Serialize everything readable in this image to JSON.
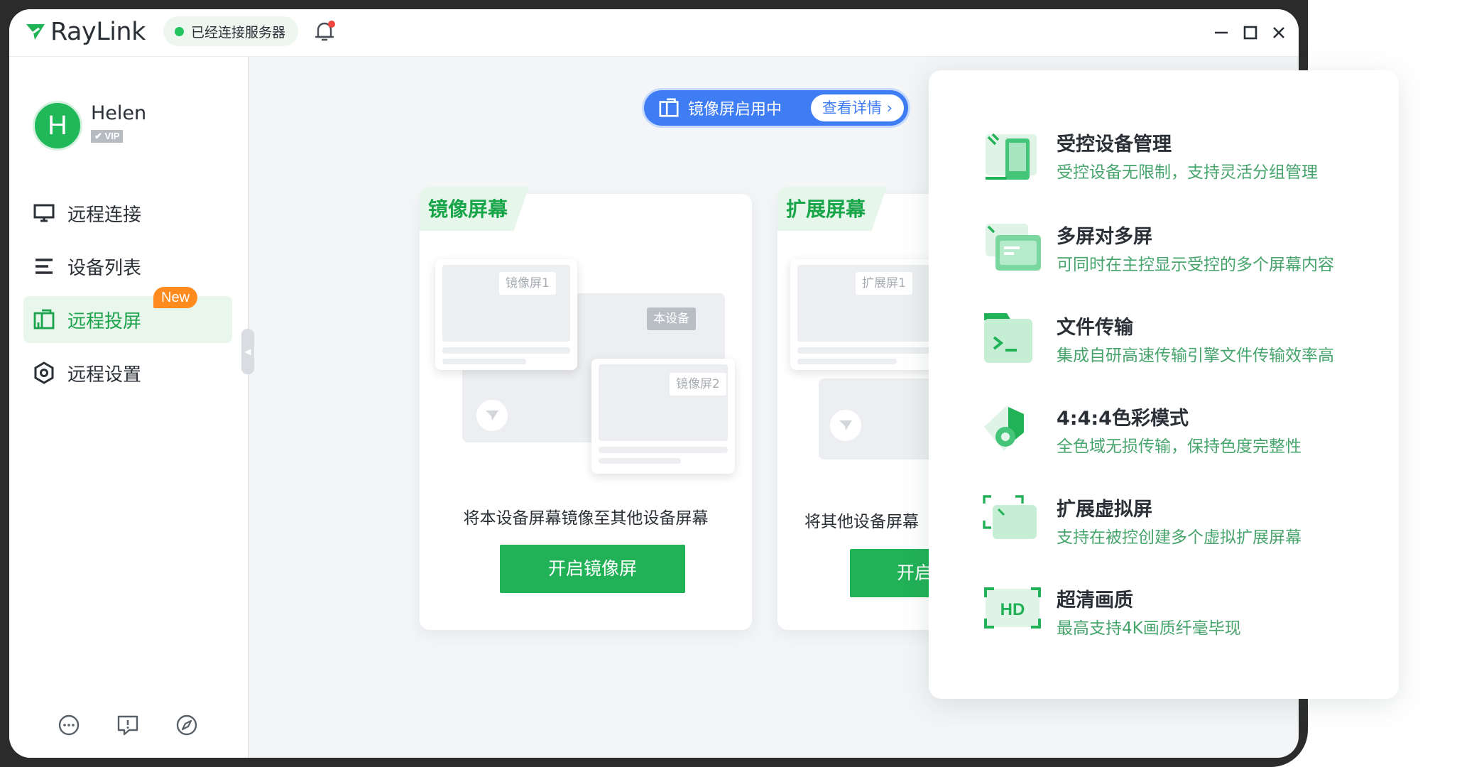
{
  "app": {
    "logo_text": "RayLink",
    "status": "已经连接服务器",
    "brand_color": "#21b157"
  },
  "user": {
    "initial": "H",
    "name": "Helen",
    "badge": "VIP"
  },
  "sidebar": {
    "items": [
      {
        "label": "远程连接",
        "icon": "monitor-icon"
      },
      {
        "label": "设备列表",
        "icon": "list-icon"
      },
      {
        "label": "远程投屏",
        "icon": "screen-cast-icon",
        "active": true,
        "badge": "New"
      },
      {
        "label": "远程设置",
        "icon": "settings-hex-icon"
      }
    ],
    "footer_icons": [
      "chat-bubble-icon",
      "feedback-icon",
      "compass-icon"
    ]
  },
  "main": {
    "mirror_status": {
      "label": "镜像屏启用中",
      "details": "查看详情"
    },
    "cards": [
      {
        "tab": "镜像屏幕",
        "screen_labels": [
          "镜像屏1",
          "本设备",
          "镜像屏2"
        ],
        "caption": "将本设备屏幕镜像至其他设备屏幕",
        "button": "开启镜像屏"
      },
      {
        "tab": "扩展屏幕",
        "screen_labels": [
          "扩展屏1"
        ],
        "caption": "将其他设备屏幕",
        "button": "开启"
      }
    ]
  },
  "features": [
    {
      "title": "受控设备管理",
      "desc": "受控设备无限制，支持灵活分组管理",
      "icon": "device-management-icon"
    },
    {
      "title": "多屏对多屏",
      "desc": "可同时在主控显示受控的多个屏幕内容",
      "icon": "multi-screen-icon"
    },
    {
      "title": "文件传输",
      "desc": "集成自研高速传输引擎文件传输效率高",
      "icon": "terminal-folder-icon"
    },
    {
      "title": "4:4:4色彩模式",
      "desc": "全色域无损传输，保持色度完整性",
      "icon": "color-mode-icon"
    },
    {
      "title": "扩展虚拟屏",
      "desc": "支持在被控创建多个虚拟扩展屏幕",
      "icon": "virtual-screen-icon"
    },
    {
      "title": "超清画质",
      "desc": "最高支持4K画质纤毫毕现",
      "icon": "hd-icon",
      "icon_text": "HD"
    }
  ]
}
